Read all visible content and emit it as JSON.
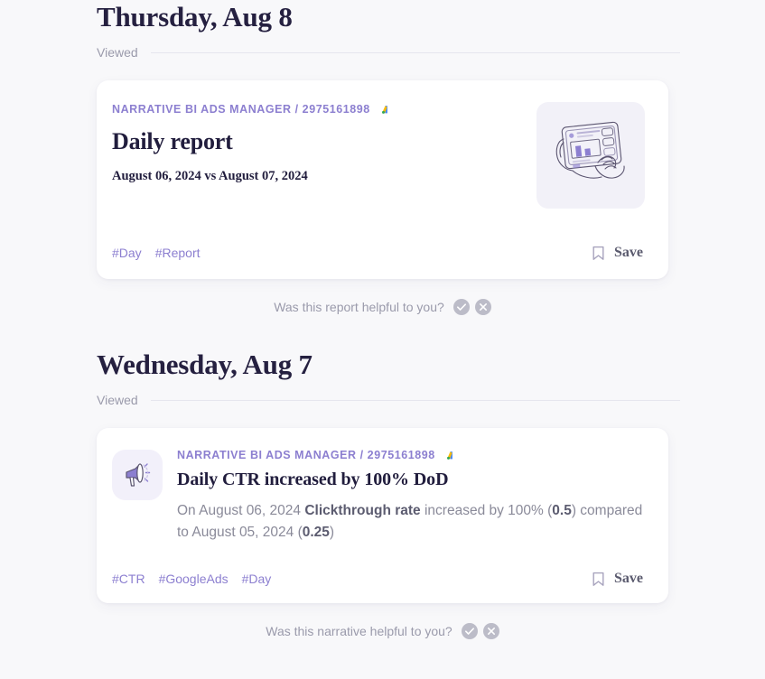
{
  "groups": [
    {
      "heading": "Thursday, Aug 8",
      "status_label": "Viewed",
      "card": {
        "type": "report",
        "source": "NARRATIVE BI ADS MANAGER / 2975161898",
        "source_icon": "google-ads-icon",
        "title": "Daily report",
        "subtitle": "August 06, 2024 vs August 07, 2024",
        "thumbnail_icon": "tablet-dashboard-illustration",
        "tags": [
          "#Day",
          "#Report"
        ],
        "save_label": "Save",
        "save_icon": "bookmark-icon"
      },
      "feedback": {
        "question": "Was this report helpful to you?",
        "yes_icon": "check-circle-icon",
        "no_icon": "close-circle-icon"
      }
    },
    {
      "heading": "Wednesday, Aug 7",
      "status_label": "Viewed",
      "card": {
        "type": "narrative",
        "badge_icon": "megaphone-icon",
        "source": "NARRATIVE BI ADS MANAGER / 2975161898",
        "source_icon": "google-ads-icon",
        "title": "Daily CTR increased by 100% DoD",
        "description_parts": [
          {
            "text": "On August 06, 2024 ",
            "bold": false
          },
          {
            "text": "Clickthrough rate",
            "bold": true
          },
          {
            "text": " increased by 100% (",
            "bold": false
          },
          {
            "text": "0.5",
            "bold": true
          },
          {
            "text": ") compared to August 05, 2024 (",
            "bold": false
          },
          {
            "text": "0.25",
            "bold": true
          },
          {
            "text": ")",
            "bold": false
          }
        ],
        "tags": [
          "#CTR",
          "#GoogleAds",
          "#Day"
        ],
        "save_label": "Save",
        "save_icon": "bookmark-icon"
      },
      "feedback": {
        "question": "Was this narrative helpful to you?",
        "yes_icon": "check-circle-icon",
        "no_icon": "close-circle-icon"
      }
    }
  ],
  "colors": {
    "background": "#f8f8fa",
    "card": "#ffffff",
    "accent_purple": "#8c7fd0",
    "heading": "#252040",
    "muted": "#9a9aab",
    "thumb_bg": "#f2f1f8",
    "badge_bg": "#f2f0fa"
  }
}
